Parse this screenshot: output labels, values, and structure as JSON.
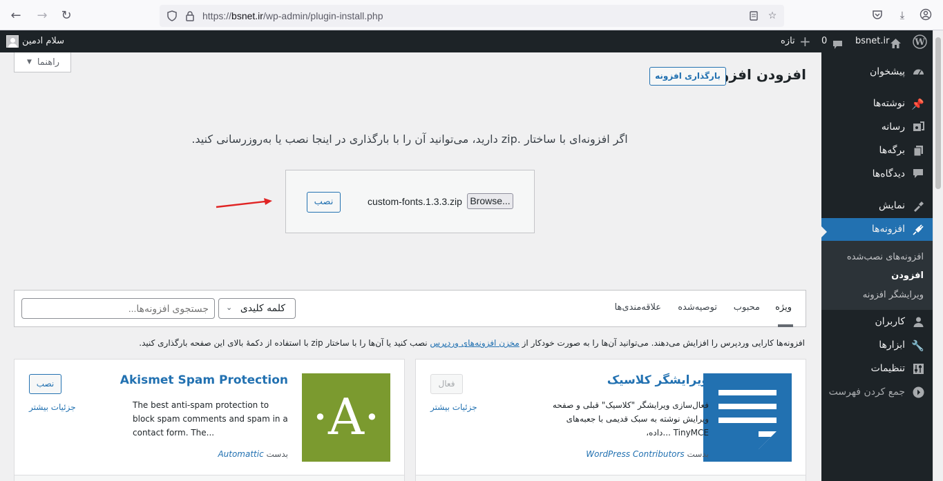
{
  "browser": {
    "url_prefix": "https://",
    "url_domain": "bsnet.ir",
    "url_path": "/wp-admin/plugin-install.php"
  },
  "adminbar": {
    "user_greeting": "سلام ادمین",
    "new_label": "تازه",
    "comments_count": "0",
    "site_name": "bsnet.ir"
  },
  "sidebar": {
    "items": [
      {
        "label": "پیشخوان",
        "icon": "dashboard-icon"
      },
      {
        "label": "نوشته‌ها",
        "icon": "pin-icon"
      },
      {
        "label": "رسانه",
        "icon": "media-icon"
      },
      {
        "label": "برگه‌ها",
        "icon": "pages-icon"
      },
      {
        "label": "دیدگاه‌ها",
        "icon": "comments-icon"
      },
      {
        "label": "نمایش",
        "icon": "appearance-icon"
      },
      {
        "label": "افزونه‌ها",
        "icon": "plugins-icon"
      },
      {
        "label": "کاربران",
        "icon": "users-icon"
      },
      {
        "label": "ابزارها",
        "icon": "tools-icon"
      },
      {
        "label": "تنظیمات",
        "icon": "settings-icon"
      },
      {
        "label": "جمع کردن فهرست",
        "icon": "collapse-icon"
      }
    ],
    "submenu": [
      "افزونه‌های نصب‌شده",
      "افزودن",
      "ویرایشگر افزونه"
    ]
  },
  "page": {
    "help_label": "راهنما",
    "title": "افزودن افزونه",
    "upload_button": "بارگذاری افزونه",
    "upload_description": "اگر افزونه‌ای با ساختار .zip دارید، می‌توانید آن را با بارگذاری در اینجا نصب یا به‌روزرسانی کنید.",
    "install_button": "نصب",
    "file_name": "custom-fonts.1.3.3.zip",
    "browse_button": "Browse...",
    "accent_color": "#2271b1"
  },
  "filter": {
    "tabs": [
      "ویژه",
      "محبوب",
      "توصیه‌شده",
      "علاقه‌مندی‌ها"
    ],
    "select_value": "کلمه کلیدی",
    "search_placeholder": "جستجوی افزونه‌ها..."
  },
  "info": {
    "before": "افزونه‌ها کارایی وردپرس را افزایش می‌دهند. می‌توانید آن‌ها را به صورت خودکار از",
    "link": "مخزن افزونه‌های وردپرس",
    "after": "نصب کنید یا آن‌ها را با ساختار zip با استفاده از دکمهٔ بالای این صفحه بارگذاری کنید."
  },
  "cards": [
    {
      "title": "ویرایشگر کلاسیک",
      "description": "فعال‌سازی ویرایشگر \"کلاسیک\" قبلی و صفحه ویرایش نوشته به سبک قدیمی با جعبه‌های TinyMCE ...داده،",
      "author_prefix": "بدست",
      "author": "WordPress Contributors",
      "button": "فعال",
      "more": "جزئیات بیشتر",
      "icon_color": "#2271b1"
    },
    {
      "title": "Akismet Spam Protection",
      "description": "The best anti-spam protection to block spam comments and spam in a contact form. The...",
      "author_prefix": "بدست",
      "author": "Automattic",
      "button": "نصب",
      "more": "جزئیات بیشتر",
      "icon_letter": "·A·",
      "icon_color": "#7b9a2f"
    }
  ]
}
